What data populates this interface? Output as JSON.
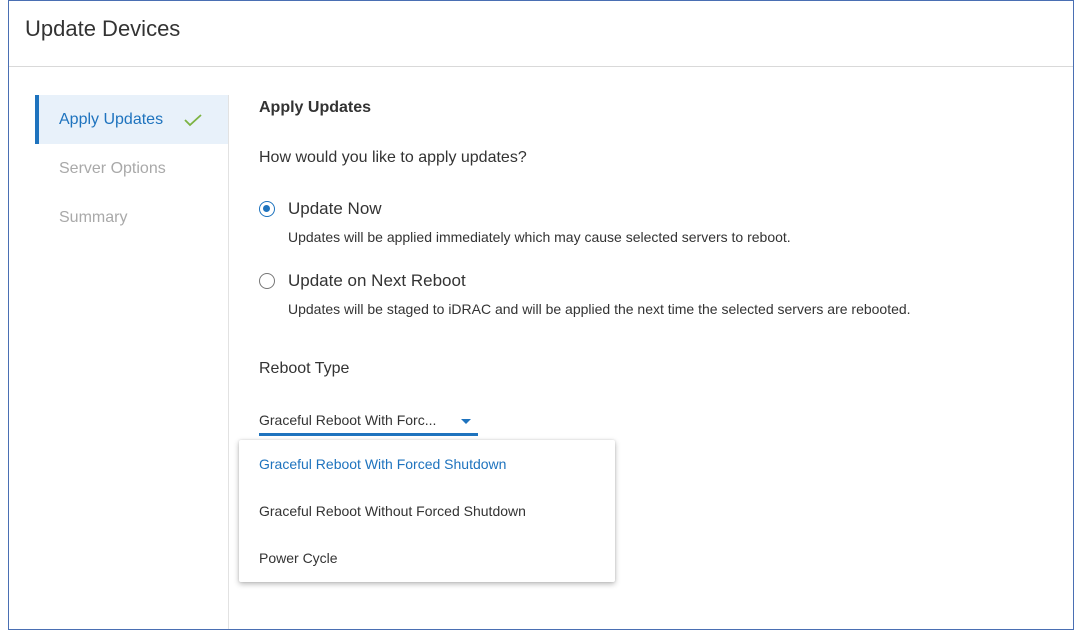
{
  "dialog": {
    "title": "Update Devices"
  },
  "sidebar": {
    "steps": [
      {
        "label": "Apply Updates",
        "state": "active",
        "completed": true
      },
      {
        "label": "Server Options",
        "state": "disabled"
      },
      {
        "label": "Summary",
        "state": "disabled"
      }
    ]
  },
  "main": {
    "section_title": "Apply Updates",
    "question": "How would you like to apply updates?",
    "options": [
      {
        "label": "Update Now",
        "description": "Updates will be applied immediately which may cause selected servers to reboot.",
        "checked": true
      },
      {
        "label": "Update on Next Reboot",
        "description": "Updates will be staged to iDRAC and will be applied the next time the selected servers are rebooted.",
        "checked": false
      }
    ],
    "reboot_type": {
      "label": "Reboot Type",
      "selected_display": "Graceful Reboot With Forc...",
      "options": [
        "Graceful Reboot With Forced Shutdown",
        "Graceful Reboot Without Forced Shutdown",
        "Power Cycle"
      ],
      "selected_index": 0
    }
  },
  "colors": {
    "accent": "#1e73be",
    "check": "#7cb342",
    "active_bg": "#e8f1fa",
    "dialog_border": "#4a6fb3"
  }
}
